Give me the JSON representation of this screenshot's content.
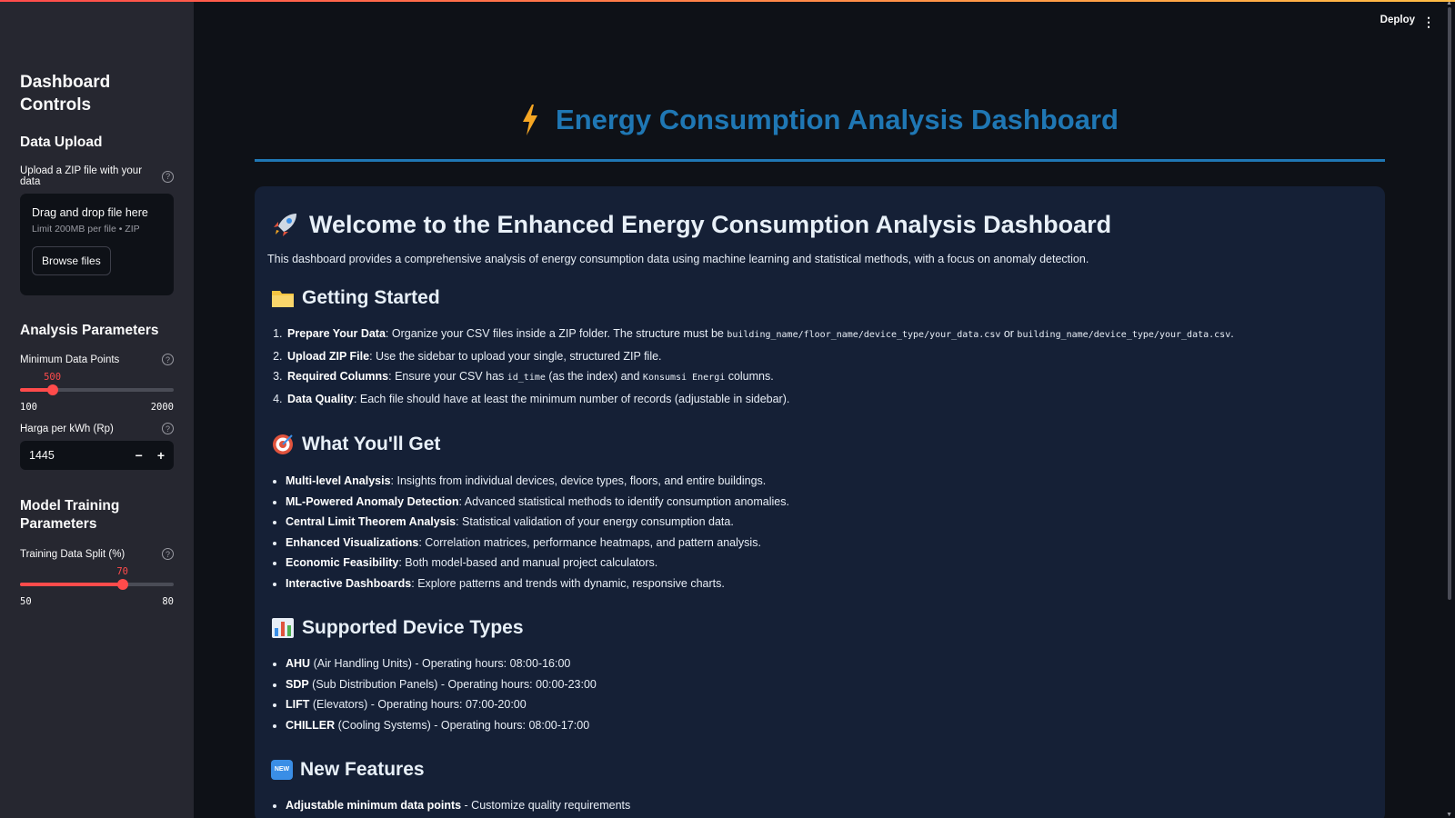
{
  "sidebar": {
    "title_line1": "Dashboard",
    "title_line2": "Controls",
    "data_upload": {
      "heading": "Data Upload",
      "label": "Upload a ZIP file with your data",
      "dropzone_main": "Drag and drop file here",
      "dropzone_sub": "Limit 200MB per file • ZIP",
      "browse_label": "Browse files"
    },
    "analysis": {
      "heading": "Analysis Parameters",
      "min_points_label": "Minimum Data Points",
      "min_points_value": "500",
      "min_points_min": "100",
      "min_points_max": "2000",
      "price_label": "Harga per kWh (Rp)",
      "price_value": "1445"
    },
    "training": {
      "heading_line1": "Model Training",
      "heading_line2": "Parameters",
      "split_label": "Training Data Split (%)",
      "split_value": "70",
      "split_min": "50",
      "split_max": "80"
    }
  },
  "header": {
    "deploy_label": "Deploy"
  },
  "main": {
    "title": "Energy Consumption Analysis Dashboard",
    "welcome_title": "Welcome to the Enhanced Energy Consumption Analysis Dashboard",
    "intro": "This dashboard provides a comprehensive analysis of energy consumption data using machine learning and statistical methods, with a focus on anomaly detection.",
    "getting_started": {
      "heading": "Getting Started",
      "s1_bold": "Prepare Your Data",
      "s1_text": ": Organize your CSV files inside a ZIP folder. The structure must be ",
      "s1_code1": "building_name/floor_name/device_type/your_data.csv",
      "s1_or": " or ",
      "s1_code2": "building_name/device_type/your_data.csv",
      "s1_end": ".",
      "s2_bold": "Upload ZIP File",
      "s2_text": ": Use the sidebar to upload your single, structured ZIP file.",
      "s3_bold": "Required Columns",
      "s3_text": ": Ensure your CSV has ",
      "s3_code1": "id_time",
      "s3_mid": " (as the index) and ",
      "s3_code2": "Konsumsi Energi",
      "s3_end": " columns.",
      "s4_bold": "Data Quality",
      "s4_text": ": Each file should have at least the minimum number of records (adjustable in sidebar)."
    },
    "what_youll_get": {
      "heading": "What You'll Get",
      "items": [
        {
          "bold": "Multi-level Analysis",
          "text": ": Insights from individual devices, device types, floors, and entire buildings."
        },
        {
          "bold": "ML-Powered Anomaly Detection",
          "text": ": Advanced statistical methods to identify consumption anomalies."
        },
        {
          "bold": "Central Limit Theorem Analysis",
          "text": ": Statistical validation of your energy consumption data."
        },
        {
          "bold": "Enhanced Visualizations",
          "text": ": Correlation matrices, performance heatmaps, and pattern analysis."
        },
        {
          "bold": "Economic Feasibility",
          "text": ": Both model-based and manual project calculators."
        },
        {
          "bold": "Interactive Dashboards",
          "text": ": Explore patterns and trends with dynamic, responsive charts."
        }
      ]
    },
    "device_types": {
      "heading": "Supported Device Types",
      "items": [
        {
          "bold": "AHU",
          "text": " (Air Handling Units) - Operating hours: 08:00-16:00"
        },
        {
          "bold": "SDP",
          "text": " (Sub Distribution Panels) - Operating hours: 00:00-23:00"
        },
        {
          "bold": "LIFT",
          "text": " (Elevators) - Operating hours: 07:00-20:00"
        },
        {
          "bold": "CHILLER",
          "text": " (Cooling Systems) - Operating hours: 08:00-17:00"
        }
      ]
    },
    "new_features": {
      "heading": "New Features",
      "badge": "NEW",
      "items": [
        {
          "bold": "Adjustable minimum data points",
          "text": " - Customize quality requirements"
        }
      ]
    }
  },
  "icons": {
    "title": "lightning-bolt-icon",
    "welcome": "rocket-icon",
    "getting_started": "folder-icon",
    "what_youll_get": "target-icon",
    "device_types": "bar-chart-icon",
    "new_features": "new-badge-icon"
  },
  "colors": {
    "accent": "#ff4b4b",
    "title_blue": "#1f77b4",
    "sidebar_bg": "#262730",
    "page_bg": "#0e1117",
    "card_bg": "#152036"
  },
  "sliders": {
    "min_points_fraction": 0.2105,
    "split_fraction": 0.6667
  }
}
